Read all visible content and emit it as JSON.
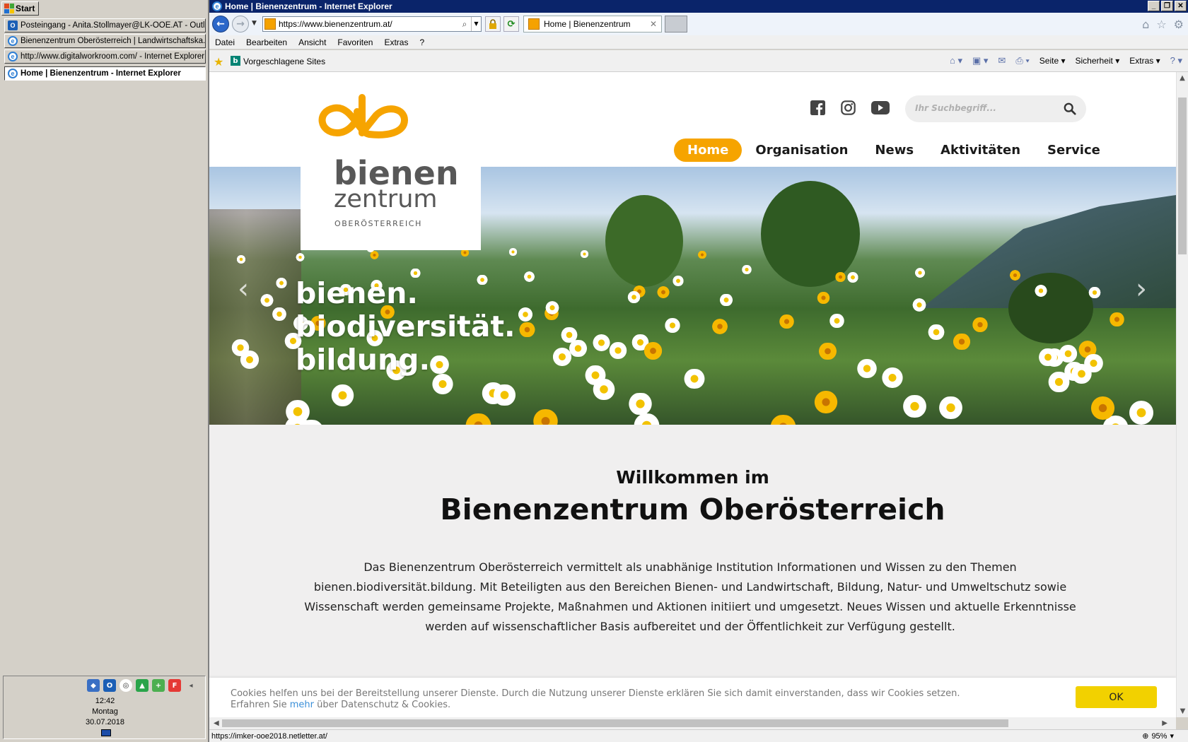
{
  "taskbar": {
    "start_label": "Start",
    "items": [
      {
        "label": "Posteingang - Anita.Stollmayer@LK-OOE.AT - Outlook",
        "icon": "outlook-icon"
      },
      {
        "label": "Bienenzentrum Oberösterreich | Landwirtschaftska...",
        "icon": "ie-icon"
      },
      {
        "label": "http://www.digitalworkroom.com/ - Internet Explorer",
        "icon": "ie-icon"
      },
      {
        "label": "Home | Bienenzentrum - Internet Explorer",
        "icon": "ie-icon",
        "active": true
      }
    ],
    "clock": {
      "time": "12:42",
      "day": "Montag",
      "date": "30.07.2018"
    }
  },
  "browser": {
    "title": "Home | Bienenzentrum - Internet Explorer",
    "address": "https://www.bienenzentrum.at/",
    "tab_label": "Home | Bienenzentrum",
    "menu": [
      "Datei",
      "Bearbeiten",
      "Ansicht",
      "Favoriten",
      "Extras",
      "?"
    ],
    "favorites_bar": {
      "suggested": "Vorgeschlagene Sites"
    },
    "command_bar": {
      "page": "Seite",
      "security": "Sicherheit",
      "tools": "Extras"
    },
    "status_url": "https://imker-ooe2018.netletter.at/",
    "zoom": "95%"
  },
  "site": {
    "logo": {
      "line1": "bienen",
      "line2": "zentrum",
      "line3": "OBERÖSTERREICH"
    },
    "search_placeholder": "Ihr Suchbegriff...",
    "nav": [
      {
        "label": "Home",
        "active": true
      },
      {
        "label": "Organisation"
      },
      {
        "label": "News"
      },
      {
        "label": "Aktivitäten"
      },
      {
        "label": "Service"
      }
    ],
    "hero": {
      "line1": "bienen.",
      "line2": "biodiversität.",
      "line3": "bildung."
    },
    "welcome": {
      "subtitle": "Willkommen im",
      "title": "Bienenzentrum Oberösterreich",
      "body": "Das Bienenzentrum Oberösterreich vermittelt als unabhänige Institution Informationen und Wissen zu den Themen bienen.biodiversität.bildung. Mit Beteiligten aus den Bereichen Bienen- und Landwirtschaft, Bildung, Natur- und Umweltschutz sowie Wissenschaft werden gemeinsame Projekte, Maßnahmen und Aktionen initiiert und umgesetzt. Neues Wissen und aktuelle Erkenntnisse werden auf wissenschaftlicher Basis aufbereitet und der Öffentlichkeit zur Verfügung gestellt."
    },
    "cookie": {
      "text1": "Cookies helfen uns bei der Bereitstellung unserer Dienste. Durch die Nutzung unserer Dienste erklären Sie sich damit einverstanden, dass wir Cookies setzen.",
      "text2_pre": "Erfahren Sie ",
      "link": "mehr",
      "text2_post": " über Datenschutz & Cookies.",
      "ok": "OK"
    },
    "colors": {
      "accent": "#f6a400",
      "cookie_button": "#f2d100"
    }
  }
}
